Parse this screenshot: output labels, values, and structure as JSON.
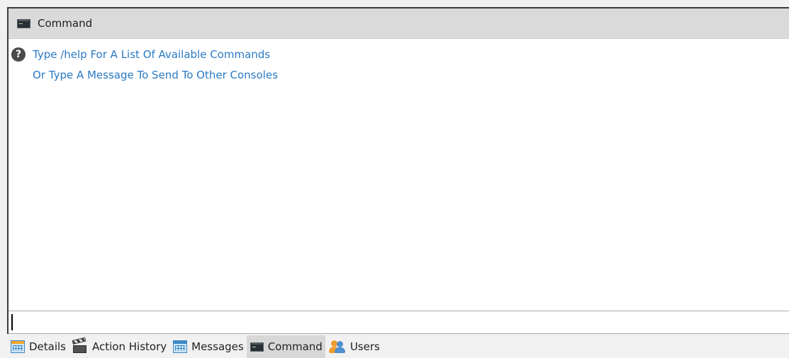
{
  "panel": {
    "title": "Command",
    "icon": "terminal-icon"
  },
  "output": {
    "lines": [
      {
        "text": "Type /help For A List Of Available Commands",
        "icon": "help-icon",
        "icon_glyph": "?"
      },
      {
        "text": "Or Type A Message To Send To Other Consoles"
      }
    ],
    "text_color": "#2a79c4"
  },
  "command_input": {
    "value": "",
    "placeholder": ""
  },
  "tabs": [
    {
      "label": "Details",
      "icon": "table-orange-icon",
      "active": false
    },
    {
      "label": "Action History",
      "icon": "clapperboard-icon",
      "active": false
    },
    {
      "label": "Messages",
      "icon": "table-blue-icon",
      "active": false
    },
    {
      "label": "Command",
      "icon": "terminal-icon",
      "active": true
    },
    {
      "label": "Users",
      "icon": "users-icon",
      "active": false
    }
  ]
}
